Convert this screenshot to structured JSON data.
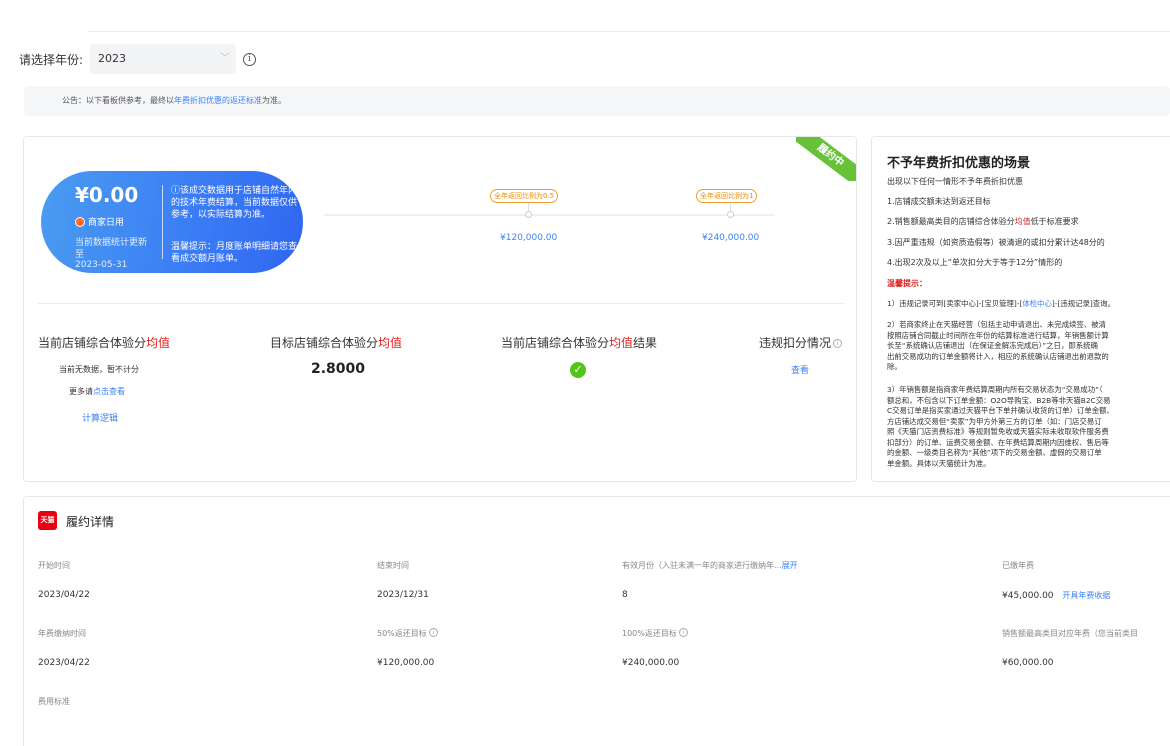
{
  "year_selector": {
    "label": "请选择年份:",
    "value": "2023"
  },
  "notice": {
    "prefix": "公告：以下看板供参考，最终以",
    "link": "年费折扣优惠的返还标准",
    "suffix": "为准。"
  },
  "status_ribbon": "履约中",
  "summary": {
    "amount": "¥0.00",
    "shop_type": "商家日用",
    "stat_note": "当前数据统计更新至",
    "stat_date": "2023-05-31",
    "desc": "ⓘ该成交数据用于店铺自然年内的技术年费结算，当前数据仅供参考，以实际结算为准。",
    "tip": "温馨提示：月度账单明细请您查看成交额月账单。"
  },
  "milestones": [
    {
      "label": "全年返回比例为0.5",
      "value": "¥120,000.00"
    },
    {
      "label": "全年返回比例为1",
      "value": "¥240,000.00"
    }
  ],
  "columns": {
    "current_prefix": "当前店铺综合体验分",
    "current_highlight": "均值",
    "target_prefix": "目标店铺综合体验分",
    "target_highlight": "均值",
    "result_prefix": "当前店铺综合体验分",
    "result_highlight": "均值",
    "result_suffix": "结果",
    "violation": "违规扣分情况",
    "no_data": "当前无数据，暂不计分",
    "more_prefix": "更多请",
    "more_link": "点击查看",
    "calc_logic": "计算逻辑",
    "target_value": "2.8000",
    "violation_link": "查看"
  },
  "side": {
    "title": "不予年费折扣优惠的场景",
    "intro": "出现以下任何一情形不予年费折扣优惠",
    "item1": "1.店铺成交额未达到返还目标",
    "item2_prefix": "2.销售额最高类目的店铺综合体验分",
    "item2_highlight": "均值",
    "item2_suffix": "低于标准要求",
    "item3": "3.因严重违规（如资质造假等）被清退的或扣分累计达48分的",
    "item4": "4.出现2次及以上“单次扣分大于等于12分”情形的",
    "warn": "温馨提示：",
    "tip1_prefix": "1）违规记录可到[卖家中心]-[宝贝管理]-[",
    "tip1_link": "体检中心",
    "tip1_suffix": "]-[违规记录]查询。",
    "tip2": [
      "2）若商家终止在天猫经营（包括主动申请退出、未完成续签、被清",
      "按照店铺合同截止时间所在年份的结算标准进行结算，年销售额计算",
      "长至“系统确认店铺退出（在保证金解冻完成后）”之日，即系统确",
      "出前交易成功的订单金额将计入，相应的系统确认店铺退出前退款的",
      "除。"
    ],
    "tip3": [
      "3）年销售额是指商家年费结算周期内所有交易状态为“交易成功”（",
      "额总和，不包含以下订单金额：O2O导购宝、B2B等非天猫B2C交易",
      "C交易订单是指买家通过天猫平台下单并确认收货的订单）订单金额、",
      "方店铺达成交易但“卖家”为甲方外第三方的订单（如：门店交易订",
      "照《天猫门店资费标准》等规则暂免收或天猫实际未收取软件服务费",
      "扣部分）的订单、运费交易金额、在年费结算周期内因维权、售后等",
      "的金额、一级类目名称为“其他”项下的交易金额、虚假的交易订单",
      "单金额。具体以天猫统计为准。"
    ]
  },
  "detail": {
    "title": "履约详情",
    "tmall_badge": "天猫",
    "labels": {
      "start": "开始时间",
      "end": "结束时间",
      "valid_months_prefix": "有效月份（入驻未满一年的商家进行缴纳年...",
      "valid_months_link": "展开",
      "paid_fee": "已缴年费",
      "pay_time": "年费缴纳时间",
      "target50": "50%返还目标",
      "target100": "100%返还目标",
      "category_fee": "销售额最高类目对应年费（您当前类目",
      "fee_standard": "费用标准"
    },
    "values": {
      "start": "2023/04/22",
      "end": "2023/12/31",
      "valid_months": "8",
      "paid_fee": "¥45,000.00",
      "invoice_link": "开具年费收据",
      "pay_time": "2023/04/22",
      "target50": "¥120,000.00",
      "target100": "¥240,000.00",
      "category_fee": "¥60,000.00"
    }
  }
}
